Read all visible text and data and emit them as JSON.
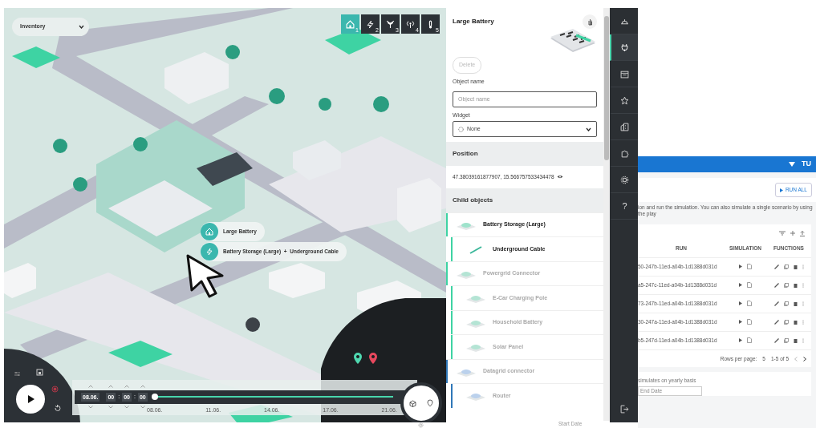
{
  "map": {
    "inventory_select": {
      "value": "Inventory"
    },
    "layers": [
      {
        "kind": "home",
        "number": "1",
        "selected": true
      },
      {
        "kind": "power",
        "number": "2",
        "selected": false
      },
      {
        "kind": "antenna",
        "number": "3",
        "selected": false
      },
      {
        "kind": "signal",
        "number": "4",
        "selected": false
      },
      {
        "kind": "thermometer",
        "number": "5",
        "selected": false
      }
    ],
    "labels": [
      {
        "kind": "home",
        "text": "Large Battery"
      },
      {
        "kind": "power",
        "text": "Battery Storage (Large)  +  Underground Cable"
      }
    ],
    "pins": [
      {
        "color": "#4fd8b0"
      },
      {
        "color": "#e8485e"
      }
    ],
    "timeline": {
      "time_fields": [
        "08.06.",
        "00",
        "00",
        "00"
      ],
      "separators": [
        ":",
        ":"
      ],
      "level": 0,
      "ticks": [
        "08.06.",
        "11.06.",
        "14.06.",
        "17.06.",
        "21.06."
      ]
    }
  },
  "panel": {
    "title": "Large Battery",
    "delete_button": {
      "label": "Delete",
      "disabled": true
    },
    "object_name": {
      "label": "Object name",
      "placeholder": "Object name"
    },
    "widget": {
      "label": "Widget",
      "value": "None"
    },
    "position": {
      "heading": "Position",
      "coordinates": "47.38039161877907, 15.566757533434478"
    },
    "child_objects": {
      "heading": "Child objects",
      "items": [
        {
          "name": "Battery Storage (Large)",
          "kind": "node",
          "active": true,
          "color": "#3ed3a3",
          "children": [
            {
              "name": "Underground Cable",
              "kind": "cable",
              "active": true,
              "color": "#3ed3a3"
            }
          ]
        },
        {
          "name": "Powergrid Connector",
          "kind": "node",
          "active": false,
          "color": "#3ed3a3",
          "children": [
            {
              "name": "E-Car Charging Pole",
              "kind": "node",
              "active": false,
              "color": "#3ed3a3"
            },
            {
              "name": "Household Battery",
              "kind": "node",
              "active": false,
              "color": "#3ed3a3"
            },
            {
              "name": "Solar Panel",
              "kind": "node",
              "active": false,
              "color": "#3ed3a3"
            }
          ]
        },
        {
          "name": "Datagrid connector",
          "kind": "node",
          "active": false,
          "color": "#2f77b8",
          "children": [
            {
              "name": "Router",
              "kind": "node",
              "active": false,
              "color": "#2f77b8"
            }
          ]
        }
      ]
    }
  },
  "sidebar": {
    "items": [
      {
        "kind": "helmet",
        "selected": false
      },
      {
        "kind": "plug",
        "selected": true
      },
      {
        "kind": "calendar",
        "selected": false
      },
      {
        "kind": "star",
        "selected": false
      },
      {
        "kind": "buildings",
        "selected": false
      },
      {
        "kind": "puzzle",
        "selected": false
      },
      {
        "kind": "gear",
        "selected": false
      },
      {
        "kind": "help",
        "glyph": "?",
        "selected": false
      },
      {
        "kind": "logout",
        "selected": false
      }
    ]
  },
  "app": {
    "logo": "TU",
    "run_all_button": "RUN ALL",
    "description": "ion and run the simulation. You can also simulate a single scenario by using the play",
    "table": {
      "columns": [
        "RUN",
        "SIMULATION",
        "FUNCTIONS"
      ],
      "rows": [
        {
          "run": "50-247b-11ed-a04b-1d1388d031d"
        },
        {
          "run": "a5-247c-11ed-a04b-1d1388d031d"
        },
        {
          "run": "73-247b-11ed-a04b-1d1388d031d"
        },
        {
          "run": "30-247a-11ed-a04b-1d1388d031d"
        },
        {
          "run": "b5-247d-11ed-a04b-1d1388d031d"
        }
      ],
      "rows_per_page_label": "Rows per page:",
      "rows_per_page": "5",
      "range": "1-5 of 5"
    },
    "yearly_note": "simulates on yearly basis",
    "end_date_label": "End Date",
    "start_date_label": "Start Date"
  }
}
